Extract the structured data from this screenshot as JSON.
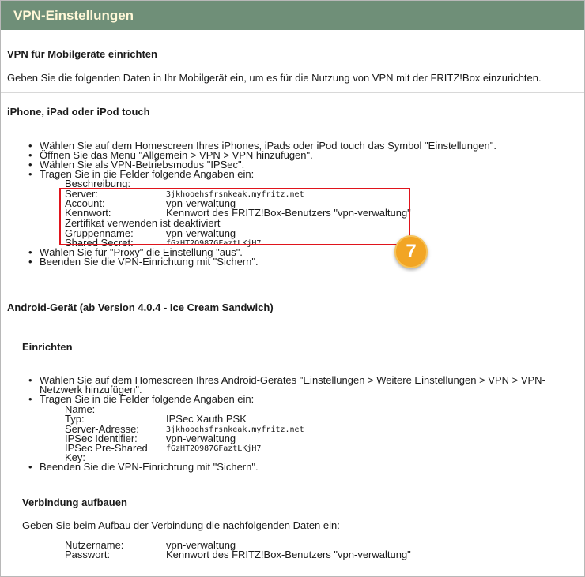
{
  "header": {
    "title": "VPN-Einstellungen"
  },
  "mobile": {
    "title": "VPN für Mobilgeräte einrichten",
    "intro": "Geben Sie die folgenden Daten in Ihr Mobilgerät ein, um es für die Nutzung von VPN mit der FRITZ!Box einzurichten."
  },
  "ios": {
    "title": "iPhone, iPad oder iPod touch",
    "steps": [
      "Wählen Sie auf dem Homescreen Ihres iPhones, iPads oder iPod touch das Symbol \"Einstellungen\".",
      "Öffnen Sie das Menü \"Allgemein > VPN > VPN hinzufügen\".",
      "Wählen Sie als VPN-Betriebsmodus \"IPSec\".",
      "Tragen Sie in die Felder folgende Angaben ein:",
      "Wählen Sie für \"Proxy\" die Einstellung \"aus\".",
      "Beenden Sie die VPN-Einrichtung mit \"Sichern\"."
    ],
    "fields": {
      "beschreibung": "Beschreibung:",
      "server_label": "Server:",
      "server_value": "3jkhooehsfrsnkeak.myfritz.net",
      "account_label": "Account:",
      "account_value": "vpn-verwaltung",
      "kennwort_label": "Kennwort:",
      "kennwort_value": "Kennwort des FRITZ!Box-Benutzers \"vpn-verwaltung\"",
      "zertifikat": "Zertifikat verwenden ist deaktiviert",
      "gruppe_label": "Gruppenname:",
      "gruppe_value": "vpn-verwaltung",
      "secret_label": "Shared Secret:",
      "secret_value": "fGzHT2O987GFaztLKjH7"
    },
    "badge": "7"
  },
  "android": {
    "title": "Android-Gerät (ab Version 4.0.4 - Ice Cream Sandwich)",
    "setup_title": "Einrichten",
    "step1_line1": "Wählen Sie auf dem Homescreen Ihres Android-Gerätes \"Einstellungen > Weitere Einstellungen > VPN > VPN-",
    "step1_line2": "Netzwerk hinzufügen\".",
    "step2": "Tragen Sie in die Felder folgende Angaben ein:",
    "step3": "Beenden Sie die VPN-Einrichtung mit \"Sichern\".",
    "fields": {
      "name_label": "Name:",
      "typ_label": "Typ:",
      "typ_value": "IPSec Xauth PSK",
      "server_label": "Server-Adresse:",
      "server_value": "3jkhooehsfrsnkeak.myfritz.net",
      "ident_label": "IPSec Identifier:",
      "ident_value": "vpn-verwaltung",
      "psk_label1": "IPSec Pre-Shared",
      "psk_label2": "Key:",
      "psk_value": "fGzHT2O987GFaztLKjH7"
    },
    "connect_title": "Verbindung aufbauen",
    "connect_intro": "Geben Sie beim Aufbau der Verbindung die nachfolgenden Daten ein:",
    "user_label": "Nutzername:",
    "user_value": "vpn-verwaltung",
    "pass_label": "Passwort:",
    "pass_value": "Kennwort des FRITZ!Box-Benutzers \"vpn-verwaltung\""
  }
}
